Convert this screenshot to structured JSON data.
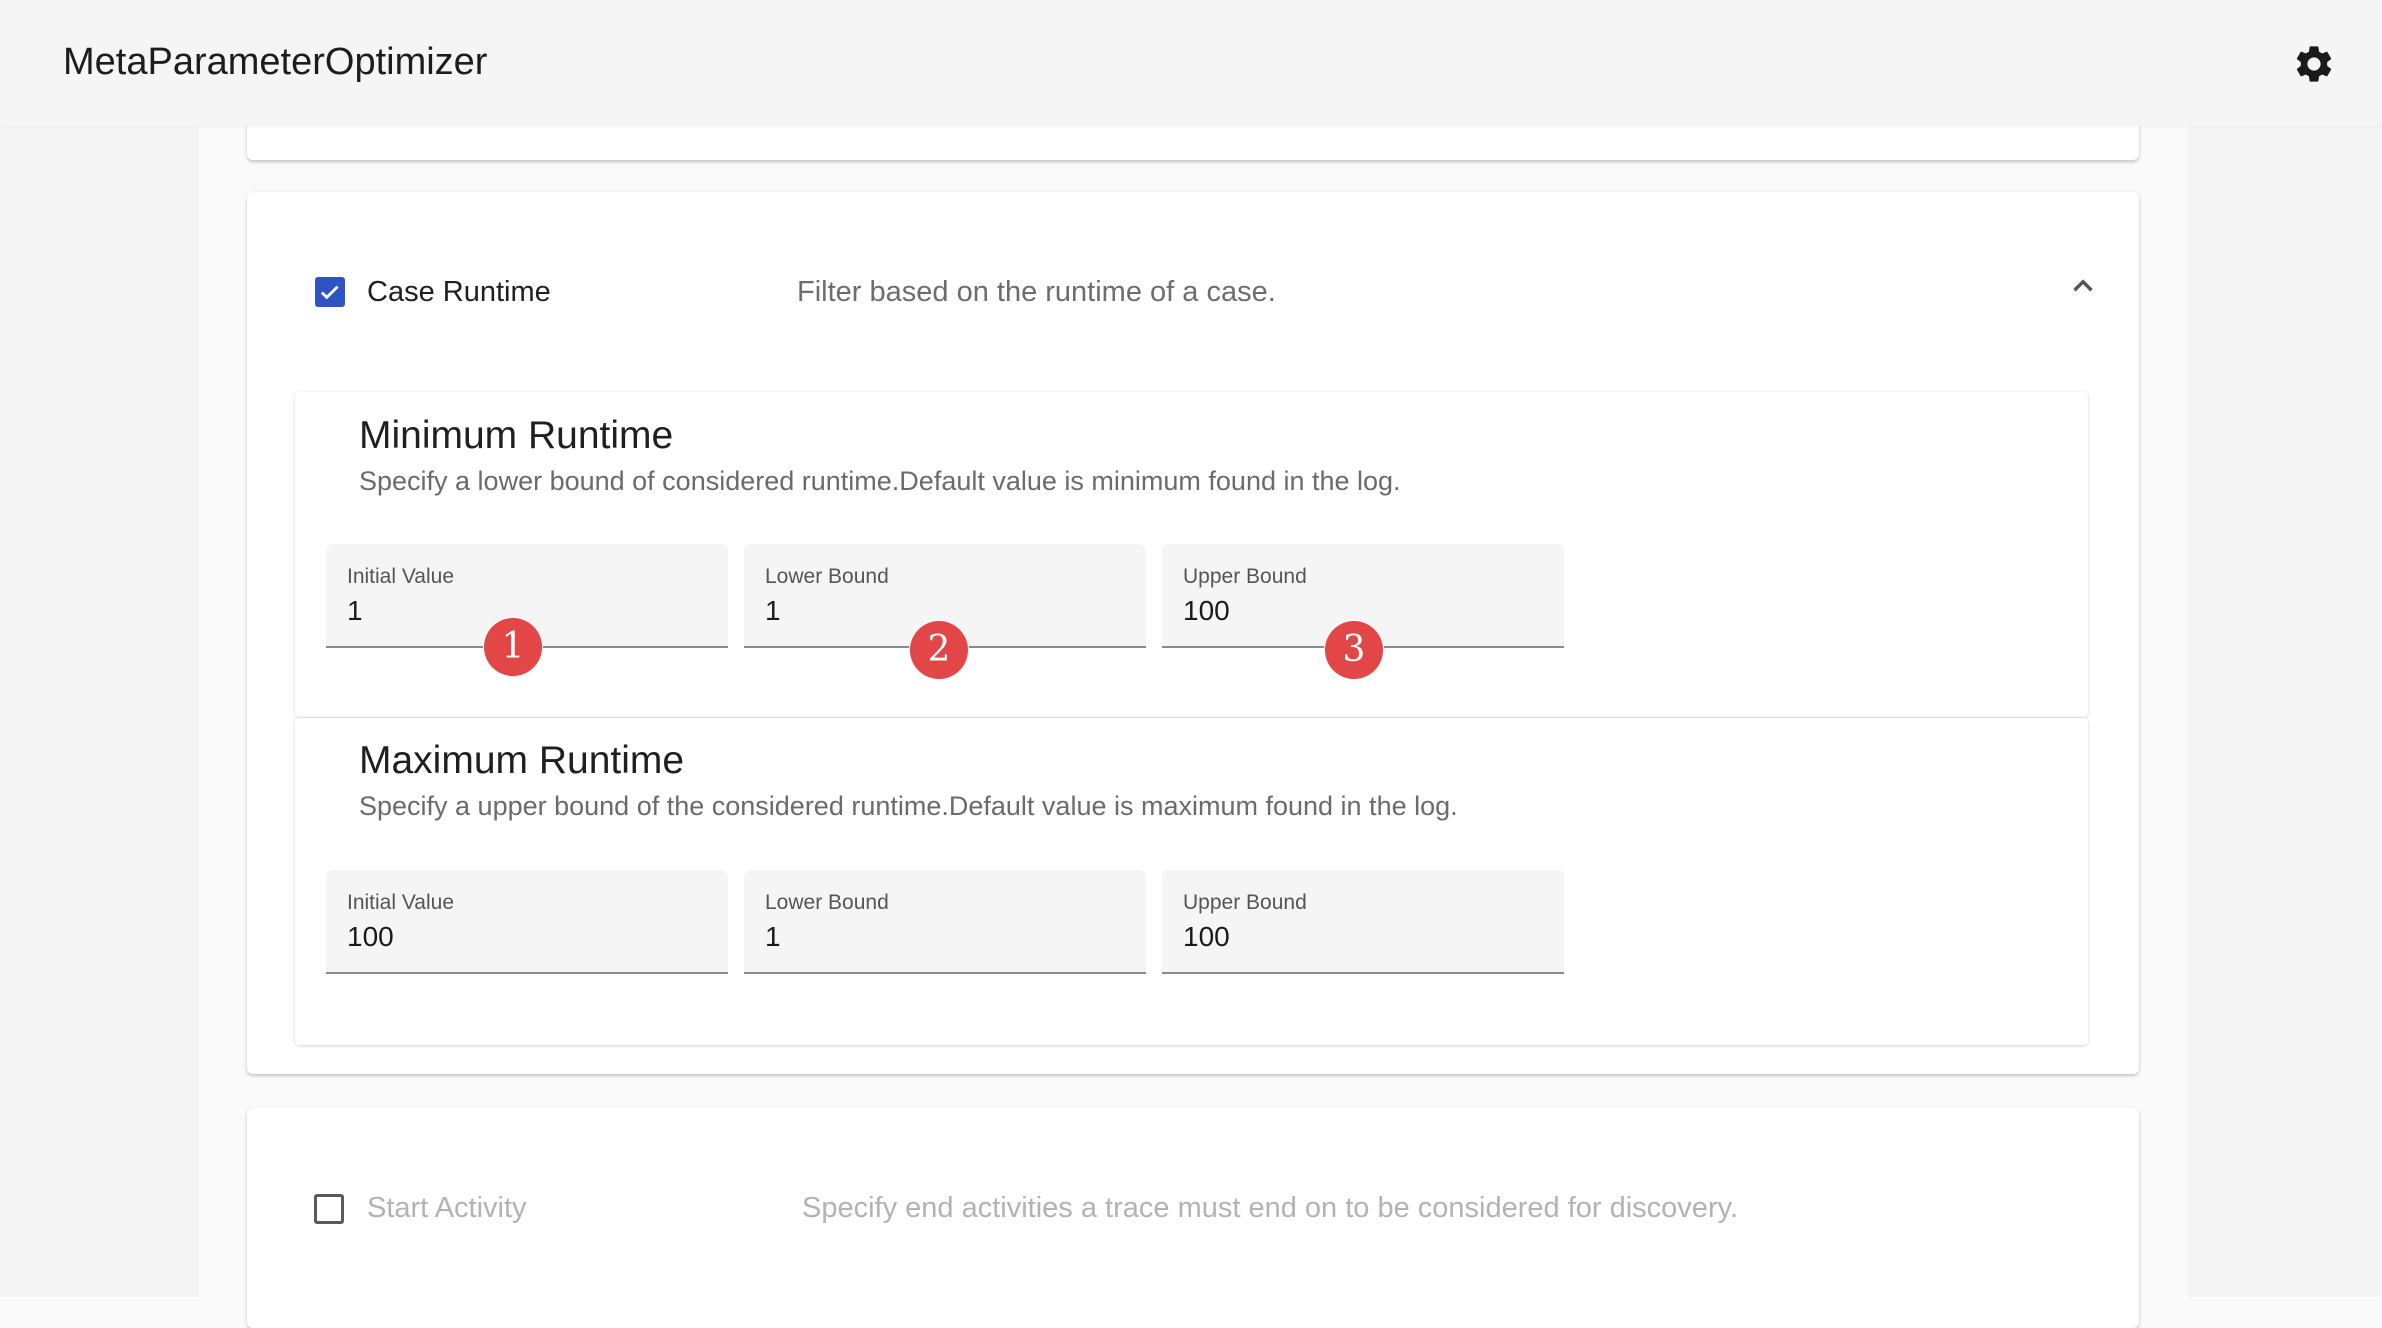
{
  "app": {
    "title": "MetaParameterOptimizer",
    "settings_icon": "gear-icon"
  },
  "filters": {
    "case_runtime": {
      "checked": true,
      "label": "Case Runtime",
      "description": "Filter based on the runtime of a case.",
      "expanded": true,
      "sections": [
        {
          "heading": "Minimum Runtime",
          "description": "Specify a lower bound of considered runtime.Default value is minimum found in the log.",
          "fields": [
            {
              "label": "Initial Value",
              "value": "1"
            },
            {
              "label": "Lower Bound",
              "value": "1"
            },
            {
              "label": "Upper Bound",
              "value": "100"
            }
          ]
        },
        {
          "heading": "Maximum Runtime",
          "description": "Specify a upper bound of the considered runtime.Default value is maximum found in the log.",
          "fields": [
            {
              "label": "Initial Value",
              "value": "100"
            },
            {
              "label": "Lower Bound",
              "value": "1"
            },
            {
              "label": "Upper Bound",
              "value": "100"
            }
          ]
        }
      ]
    },
    "start_activity": {
      "checked": false,
      "label": "Start Activity",
      "description": "Specify end activities a trace must end on to be considered for discovery."
    }
  },
  "annotations": {
    "markers": [
      "1",
      "2",
      "3"
    ],
    "color": "#e24646"
  },
  "colors": {
    "checkbox_accent": "#2f52c4",
    "appbar_bg": "#f5f5f5"
  }
}
